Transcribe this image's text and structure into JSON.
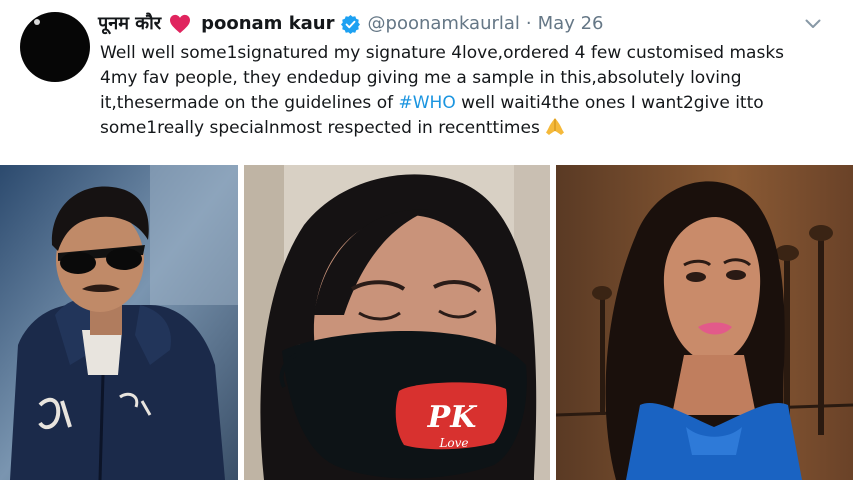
{
  "tweet": {
    "display_name_hindi": "पूनम कौर",
    "display_name": "poonam kaur",
    "handle": "@poonamkaurlal",
    "separator": "·",
    "date": "May 26",
    "text_before_hashtag": "Well well some1signatured my signature 4love,ordered 4 few customised masks 4my fav people, they endedup giving me a sample in this,absolutely loving it,thesermade on the guidelines of ",
    "hashtag": "#WHO",
    "text_after_hashtag": " well waiti4the ones I want2give itto some1really  specialnmost respected in recenttimes",
    "mask_print": {
      "initials": "PK",
      "word": "Love"
    }
  },
  "colors": {
    "link": "#1b95e0",
    "secondary_text": "#657786",
    "heart": "#e0245e",
    "verified": "#1da1f2"
  },
  "icons": [
    "heart-icon",
    "verified-badge-icon",
    "chevron-down-icon",
    "folded-hands-emoji-icon"
  ]
}
